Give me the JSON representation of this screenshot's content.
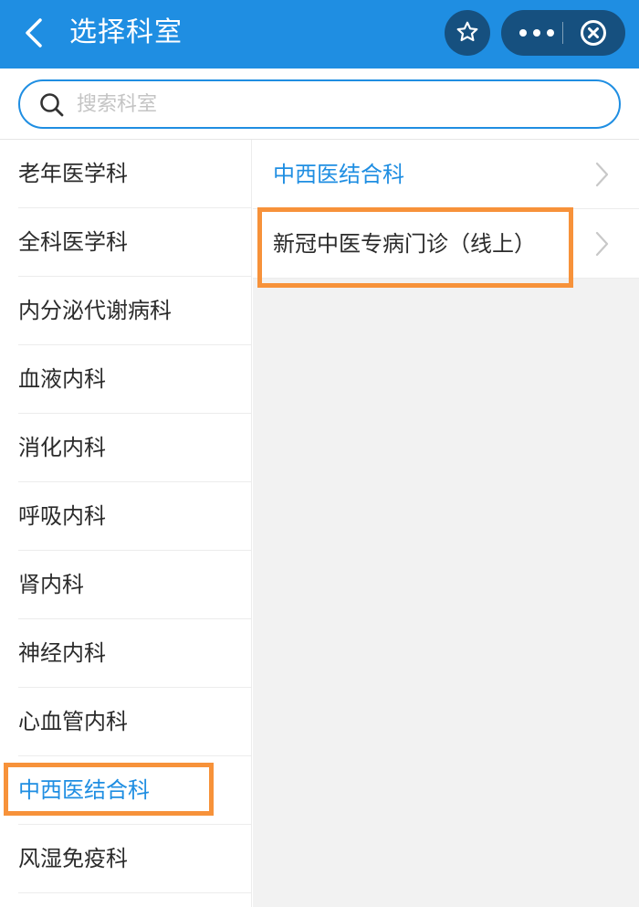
{
  "header": {
    "title": "选择科室",
    "background": "#1f8ee2",
    "capsule_background": "#16507f",
    "icons": [
      "chevron-left-icon",
      "star-icon",
      "more-dots-icon",
      "close-circle-icon"
    ]
  },
  "search": {
    "placeholder": "搜索科室",
    "value": "",
    "border_color": "#1f8ee2"
  },
  "departments": [
    {
      "label": "老年医学科"
    },
    {
      "label": "全科医学科"
    },
    {
      "label": "内分泌代谢病科"
    },
    {
      "label": "血液内科"
    },
    {
      "label": "消化内科"
    },
    {
      "label": "呼吸内科"
    },
    {
      "label": "肾内科"
    },
    {
      "label": "神经内科"
    },
    {
      "label": "心血管内科"
    },
    {
      "label": "中西医结合科",
      "selected": true
    },
    {
      "label": "风湿免疫科"
    }
  ],
  "sub_departments": [
    {
      "label": "中西医结合科",
      "selected": true
    },
    {
      "label": "新冠中医专病门诊（线上）"
    }
  ],
  "colors": {
    "accent": "#1f8ee2",
    "highlight_box": "#f7923a",
    "text": "#2b2b2b"
  }
}
